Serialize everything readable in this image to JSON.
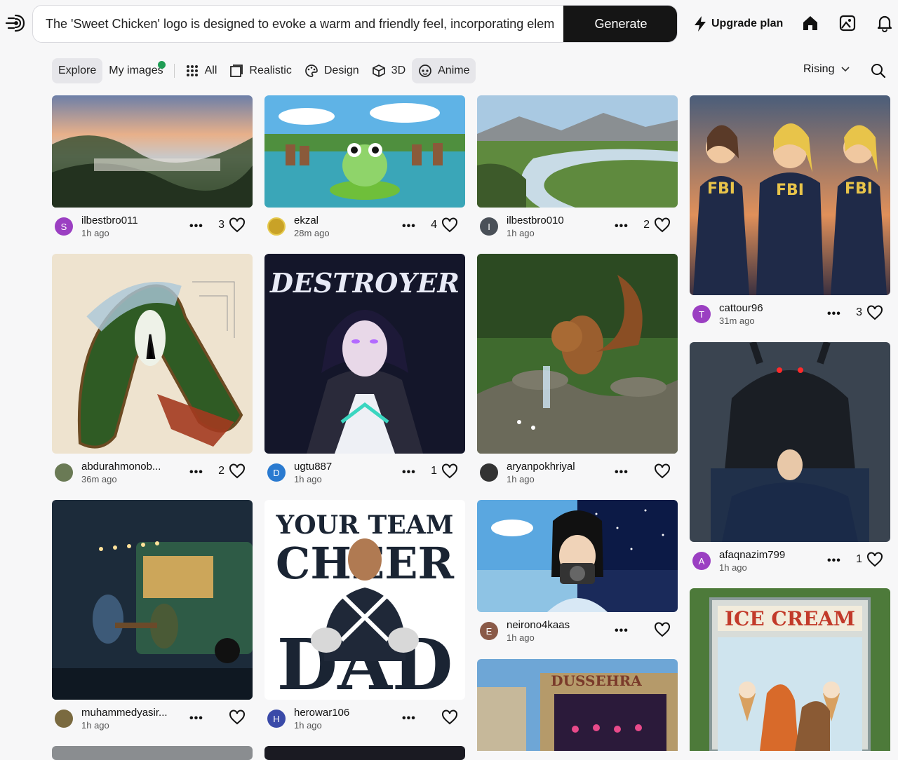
{
  "prompt": {
    "value": "The 'Sweet Chicken' logo is designed to evoke a warm and friendly feel, incorporating elem",
    "generate_label": "Generate"
  },
  "header": {
    "upgrade_label": "Upgrade plan",
    "icons": [
      "bolt-icon",
      "home-icon",
      "gallery-icon",
      "bell-icon"
    ]
  },
  "filters": {
    "explore": "Explore",
    "my_images": "My images",
    "all": "All",
    "realistic": "Realistic",
    "design": "Design",
    "three_d": "3D",
    "anime": "Anime",
    "sort": "Rising"
  },
  "cards": [
    {
      "user": "ilbestbro011",
      "ago": "1h ago",
      "likes": "3",
      "avatar": "S",
      "avatar_color": "#9b3fc2",
      "image": "Misty mountain valley at sunset"
    },
    {
      "user": "ekzal",
      "ago": "28m ago",
      "likes": "4",
      "avatar": "",
      "avatar_color": "#c9a227",
      "image": "Frog on lily pad with chibi animals"
    },
    {
      "user": "ilbestbro010",
      "ago": "1h ago",
      "likes": "2",
      "avatar": "I",
      "avatar_color": "#4a5058",
      "image": "River through green meadow"
    },
    {
      "user": "cattour96",
      "ago": "31m ago",
      "likes": "3",
      "avatar": "T",
      "avatar_color": "#9b3fc2",
      "image": "Three FBI agents"
    },
    {
      "user": "abdurahmonob...",
      "ago": "36m ago",
      "likes": "2",
      "avatar": "",
      "avatar_color": "#6a7a55",
      "image": "Letter A landscape art"
    },
    {
      "user": "ugtu887",
      "ago": "1h ago",
      "likes": "1",
      "avatar": "D",
      "avatar_color": "#2a7ad0",
      "image": "The Destroyer anime character"
    },
    {
      "user": "aryanpokhriyal",
      "ago": "1h ago",
      "likes": "",
      "avatar": "",
      "avatar_color": "#333333",
      "image": "Squirrel by a stream"
    },
    {
      "user": "afaqnazim799",
      "ago": "1h ago",
      "likes": "1",
      "avatar": "A",
      "avatar_color": "#9b3fc2",
      "image": "Shadow monster above bed"
    },
    {
      "user": "muhammedyasir...",
      "ago": "1h ago",
      "likes": "",
      "avatar": "",
      "avatar_color": "#7a6a40",
      "image": "Food truck at night in rain"
    },
    {
      "user": "herowar106",
      "ago": "1h ago",
      "likes": "",
      "avatar": "H",
      "avatar_color": "#3a4aa8",
      "image": "Your Team Cheer Dad"
    },
    {
      "user": "neirono4kaas",
      "ago": "1h ago",
      "likes": "",
      "avatar": "E",
      "avatar_color": "#8a5a48",
      "image": "Girl with camera, day and night"
    },
    {
      "user": "",
      "ago": "",
      "likes": "",
      "avatar": "",
      "avatar_color": "#888",
      "image": "Dussehra festival stage"
    },
    {
      "user": "",
      "ago": "",
      "likes": "",
      "avatar": "",
      "avatar_color": "#888",
      "image": "Ice cream stand with fox"
    }
  ],
  "image_text": {
    "destroyer": "DESTROYER",
    "cheer_top": "YOUR TEAM",
    "cheer_mid": "CHEER",
    "cheer_bot": "DAD",
    "ice_cream": "ICE CREAM",
    "fbi": "FBI",
    "dussehra": "DUSSEHRA"
  }
}
